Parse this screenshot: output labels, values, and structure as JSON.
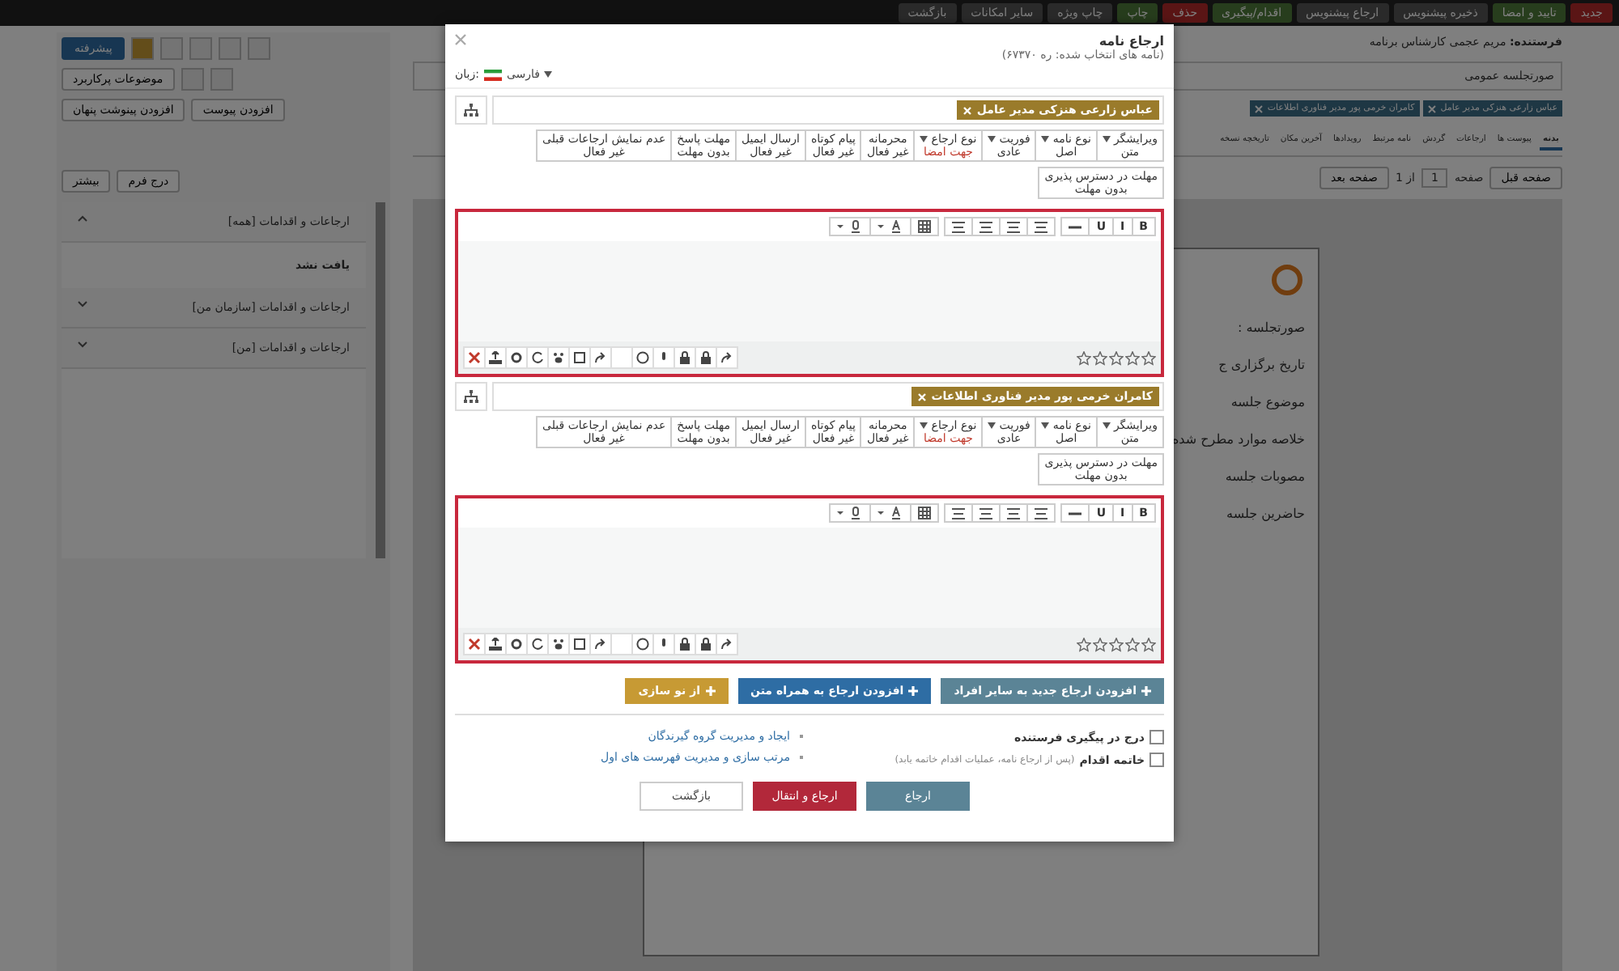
{
  "top_toolbar": [
    {
      "label": "جدید",
      "kind": "danger"
    },
    {
      "label": "تایید و امضا",
      "kind": "success"
    },
    {
      "label": "ذخیره پیشنویس",
      "kind": "default"
    },
    {
      "label": "ارجاع پیشنویس",
      "kind": "default"
    },
    {
      "label": "اقدام/پیگیری",
      "kind": "success"
    },
    {
      "label": "حذف",
      "kind": "danger"
    },
    {
      "label": "چاپ",
      "kind": "success"
    },
    {
      "label": "چاپ ویژه",
      "kind": "default"
    },
    {
      "label": "سایر امکانات",
      "kind": "default"
    },
    {
      "label": "بازگشت",
      "kind": "default"
    }
  ],
  "left_panel": {
    "advanced_button": "پیشرفته",
    "frequent_subjects": "موضوعات پرکاربرد",
    "add_attachment": "افزودن پیوست",
    "add_hidden_note": "افزودن پینوشت پنهان",
    "insert_form": "درج فرم",
    "more": "بیشتر",
    "accordion": [
      {
        "title": "ارجاعات و اقدامات [همه]",
        "expanded": true,
        "body": "یافت نشد"
      },
      {
        "title": "ارجاعات و اقدامات [سازمان من]",
        "expanded": false
      },
      {
        "title": "ارجاعات و اقدامات [من]",
        "expanded": false
      }
    ]
  },
  "letter": {
    "sender_label": "فرستنده:",
    "sender": "مریم عجمی کارشناس برنامه",
    "subject": "صورتجلسه عمومی",
    "recipient_tags": [
      "عباس زارعی هنزکی مدیر عامل",
      "کامران خرمی پور مدیر فناوری اطلاعات"
    ],
    "tabs": [
      {
        "label": "بدنه",
        "selected": true
      },
      {
        "label": "پیوست ها",
        "selected": false
      },
      {
        "label": "ارجاعات",
        "selected": false
      },
      {
        "label": "گردش",
        "selected": false
      },
      {
        "label": "نامه مرتبط",
        "selected": false
      },
      {
        "label": "رویدادها",
        "selected": false
      },
      {
        "label": "آخرین مکان",
        "selected": false
      },
      {
        "label": "تاریخچه نسخه",
        "selected": false
      }
    ],
    "pager": {
      "page_label": "صفحه",
      "page": "1",
      "of": "از 1",
      "next": "صفحه بعد",
      "prev": "صفحه قبل"
    },
    "preview_lines": [
      "صورتجلسه :",
      "تاریخ برگزاری ج",
      "موضوع جلسه",
      "خلاصه موارد مطرح شده",
      "مصوبات جلسه",
      "حاضرین جلسه"
    ]
  },
  "dialog": {
    "title": "ارجاع نامه",
    "subtitle": "(نامه های انتخاب شده: ره ۶۷۳۷۰)",
    "language_label": "زبان:",
    "language": "فارسی",
    "recipients": [
      {
        "name": "عباس زارعی هنزکی مدیر عامل",
        "options": [
          {
            "label": "ویرایشگر",
            "dropdown": true,
            "value": "متن",
            "highlighted": false
          },
          {
            "label": "نوع نامه",
            "dropdown": true,
            "value": "اصل",
            "highlighted": false
          },
          {
            "label": "فوریت",
            "dropdown": true,
            "value": "عادی",
            "highlighted": false
          },
          {
            "label": "نوع ارجاع",
            "dropdown": true,
            "value": "جهت امضا",
            "highlighted": true
          },
          {
            "label": "محرمانه",
            "dropdown": false,
            "value": "غیر فعال",
            "highlighted": false
          },
          {
            "label": "پیام کوتاه",
            "dropdown": false,
            "value": "غیر فعال",
            "highlighted": false
          },
          {
            "label": "ارسال ایمیل",
            "dropdown": false,
            "value": "غیر فعال",
            "highlighted": false
          },
          {
            "label": "مهلت پاسخ",
            "dropdown": false,
            "value": "بدون مهلت",
            "highlighted": false
          },
          {
            "label": "عدم نمایش ارجاعات قبلی",
            "dropdown": false,
            "value": "غیر فعال",
            "highlighted": false
          }
        ],
        "availability": {
          "label": "مهلت در دسترس پذیری",
          "value": "بدون مهلت"
        },
        "format_buttons": [
          "B",
          "I",
          "U"
        ],
        "stars": 0
      },
      {
        "name": "کامران خرمی پور مدیر فناوری اطلاعات",
        "options": [
          {
            "label": "ویرایشگر",
            "dropdown": true,
            "value": "متن",
            "highlighted": false
          },
          {
            "label": "نوع نامه",
            "dropdown": true,
            "value": "اصل",
            "highlighted": false
          },
          {
            "label": "فوریت",
            "dropdown": true,
            "value": "عادی",
            "highlighted": false
          },
          {
            "label": "نوع ارجاع",
            "dropdown": true,
            "value": "جهت امضا",
            "highlighted": true
          },
          {
            "label": "محرمانه",
            "dropdown": false,
            "value": "غیر فعال",
            "highlighted": false
          },
          {
            "label": "پیام کوتاه",
            "dropdown": false,
            "value": "غیر فعال",
            "highlighted": false
          },
          {
            "label": "ارسال ایمیل",
            "dropdown": false,
            "value": "غیر فعال",
            "highlighted": false
          },
          {
            "label": "مهلت پاسخ",
            "dropdown": false,
            "value": "بدون مهلت",
            "highlighted": false
          },
          {
            "label": "عدم نمایش ارجاعات قبلی",
            "dropdown": false,
            "value": "غیر فعال",
            "highlighted": false
          }
        ],
        "availability": {
          "label": "مهلت در دسترس پذیری",
          "value": "بدون مهلت"
        },
        "format_buttons": [
          "B",
          "I",
          "U"
        ],
        "stars": 0
      }
    ],
    "action_buttons": [
      {
        "label": "افزودن ارجاع جدید به سایر افراد",
        "kind": "slate"
      },
      {
        "label": "افزودن ارجاع به همراه متن",
        "kind": "blue"
      },
      {
        "label": "از نو سازی",
        "kind": "gold"
      }
    ],
    "checks": [
      {
        "label": "درج در پیگیری فرستنده",
        "checked": false
      },
      {
        "label": "خاتمه اقدام",
        "note": "(پس از ارجاع نامه، عملیات اقدام خاتمه یابد)",
        "checked": false
      }
    ],
    "links": [
      "ایجاد و مدیریت گروه گیرندگان",
      "مرتب سازی و مدیریت فهرست های اول"
    ],
    "footer_buttons": [
      {
        "label": "ارجاع",
        "kind": "slate"
      },
      {
        "label": "ارجاع و انتقال",
        "kind": "red"
      },
      {
        "label": "بازگشت",
        "kind": "plain"
      }
    ]
  }
}
